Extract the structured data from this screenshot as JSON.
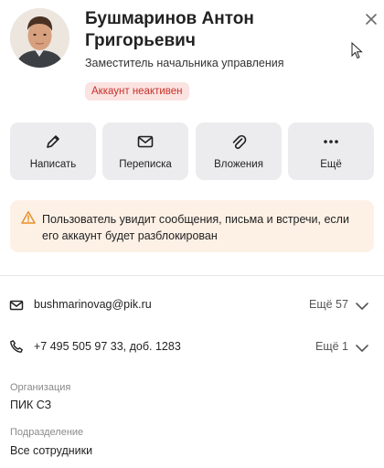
{
  "profile": {
    "name": "Бушмаринов Антон Григорьевич",
    "position": "Заместитель начальника управления",
    "status_badge": "Аккаунт неактивен"
  },
  "actions": [
    {
      "label": "Написать",
      "icon": "pencil-icon"
    },
    {
      "label": "Переписка",
      "icon": "envelope-icon"
    },
    {
      "label": "Вложения",
      "icon": "paperclip-icon"
    },
    {
      "label": "Ещё",
      "icon": "more-dots-icon"
    }
  ],
  "warning": {
    "text": "Пользователь увидит сообщения, письма и встречи, если его аккаунт будет разблокирован",
    "icon": "warning-triangle-icon"
  },
  "contacts": {
    "email": {
      "value": "bushmarinovag@pik.ru",
      "more": "Ещё 57",
      "icon": "envelope-icon"
    },
    "phone": {
      "value": "+7 495 505 97 33, доб. 1283",
      "more": "Ещё 1",
      "icon": "phone-icon"
    }
  },
  "details": [
    {
      "label": "Организация",
      "value": "ПИК СЗ"
    },
    {
      "label": "Подразделение",
      "value": "Все сотрудники"
    }
  ],
  "colors": {
    "badge_bg": "#fbe3e1",
    "badge_text": "#c6322a",
    "warning_bg": "#fdf1e6",
    "warning_icon": "#e8902a",
    "action_bg": "#ececee"
  }
}
